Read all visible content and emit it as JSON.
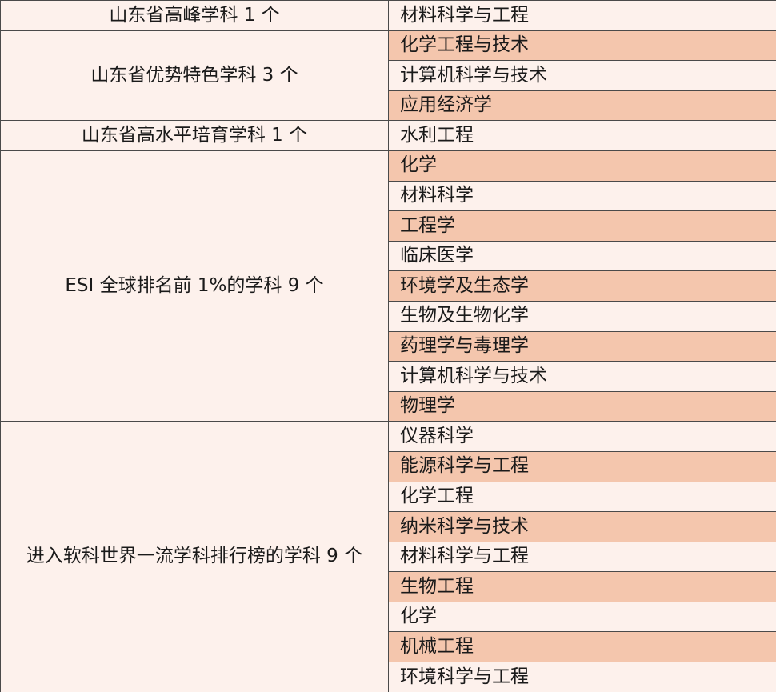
{
  "groups": [
    {
      "category": "山东省高峰学科 1 个",
      "subjects": [
        "材料科学与工程"
      ]
    },
    {
      "category": "山东省优势特色学科 3 个",
      "subjects": [
        "化学工程与技术",
        "计算机科学与技术",
        "应用经济学"
      ]
    },
    {
      "category": "山东省高水平培育学科 1 个",
      "subjects": [
        "水利工程"
      ]
    },
    {
      "category": "ESI 全球排名前 1%的学科 9 个",
      "subjects": [
        "化学",
        "材料科学",
        "工程学",
        "临床医学",
        "环境学及生态学",
        "生物及生物化学",
        "药理学与毒理学",
        "计算机科学与技术",
        "物理学"
      ]
    },
    {
      "category": "进入软科世界一流学科排行榜的学科 9 个",
      "subjects": [
        "仪器科学",
        "能源科学与工程",
        "化学工程",
        "纳米科学与技术",
        "材料科学与工程",
        "生物工程",
        "化学",
        "机械工程",
        "环境科学与工程"
      ]
    }
  ],
  "colors": {
    "light_row": "#fdf1ec",
    "dark_row": "#f4c6ad",
    "border": "#4a4a4a"
  }
}
